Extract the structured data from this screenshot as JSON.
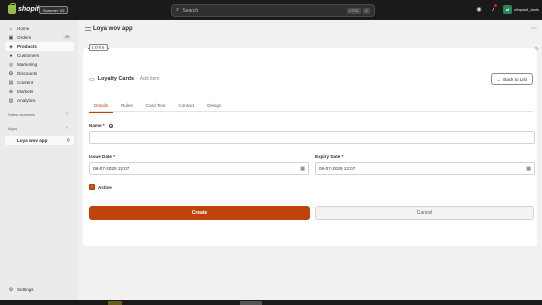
{
  "topbar": {
    "brand": "shopify",
    "edition": "Summer '25",
    "search_placeholder": "Search",
    "search_shortcut": "CTRL",
    "search_shortcut_key": "K",
    "store_name": "ottapadi_fanis",
    "avatar_initials": "of"
  },
  "sidebar": {
    "items": [
      {
        "label": "Home",
        "icon": "home-icon"
      },
      {
        "label": "Orders",
        "icon": "orders-icon",
        "badge": "29"
      },
      {
        "label": "Products",
        "icon": "products-icon"
      },
      {
        "label": "Customers",
        "icon": "customers-icon"
      },
      {
        "label": "Marketing",
        "icon": "marketing-icon"
      },
      {
        "label": "Discounts",
        "icon": "discounts-icon"
      },
      {
        "label": "Content",
        "icon": "content-icon"
      },
      {
        "label": "Markets",
        "icon": "markets-icon"
      },
      {
        "label": "Analytics",
        "icon": "analytics-icon"
      }
    ],
    "sales_channels_label": "Sales channels",
    "apps_label": "Apps",
    "app_item": "Loya wov app",
    "settings_label": "Settings"
  },
  "app_header": {
    "title": "Loya wov app"
  },
  "logo_text": "LOYA",
  "page": {
    "title": "Loyalty Cards",
    "separator": "·",
    "subtitle": "Add item",
    "back_button": "Back to List"
  },
  "tabs": [
    "Details",
    "Rules",
    "Card Text",
    "Contact",
    "Design"
  ],
  "form": {
    "name_label": "Name",
    "name_value": "",
    "issue_label": "Issue Date",
    "issue_value": "08-07-2025 12:07",
    "expiry_label": "Expiry Date",
    "expiry_value": "08-07-2029 12:07",
    "required_mark": "*",
    "active_label": "Active",
    "create_button": "Create",
    "cancel_button": "Cancel"
  },
  "colors": {
    "accent": "#c0430c",
    "topbar": "#1a1a1a",
    "sidebar": "#ebebeb",
    "avatar": "#29845a"
  }
}
